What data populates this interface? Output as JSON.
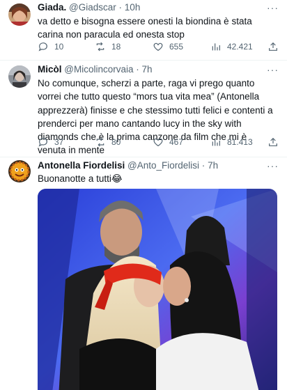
{
  "tweets": [
    {
      "name": "Giada.",
      "handle": "@Giadscar",
      "dot": "·",
      "time": "10h",
      "text": "va detto e bisogna essere onesti la biondina è stata carina non paracula ed onesta stop",
      "replies": "10",
      "retweets": "18",
      "likes": "655",
      "views": "42.421"
    },
    {
      "name": "Micòl",
      "handle": "@Micolincorvaia",
      "dot": "·",
      "time": "7h",
      "text": "No comunque, scherzi a parte, raga vi prego quanto vorrei che tutto questo “mors tua vita mea” (Antonella apprezzerà) finisse e che stessimo tutti felici e contenti a prenderci per mano cantando lucy in the sky with diamonds che è la prima canzone da film che mi è venuta in mente",
      "replies": "37",
      "retweets": "80",
      "likes": "467",
      "views": "81.413"
    },
    {
      "name": "Antonella Fiordelisi",
      "handle": "@Anto_Fiordelisi",
      "dot": "·",
      "time": "7h",
      "text": "Buonanotte a tutti😂"
    }
  ],
  "more_glyph": "···",
  "colors": {
    "text": "#0f1419",
    "secondary": "#536471",
    "divider": "#eff3f4",
    "thread": "#cfd9de"
  },
  "icons": [
    "reply-icon",
    "retweet-icon",
    "like-icon",
    "views-icon",
    "share-icon",
    "more-icon"
  ]
}
